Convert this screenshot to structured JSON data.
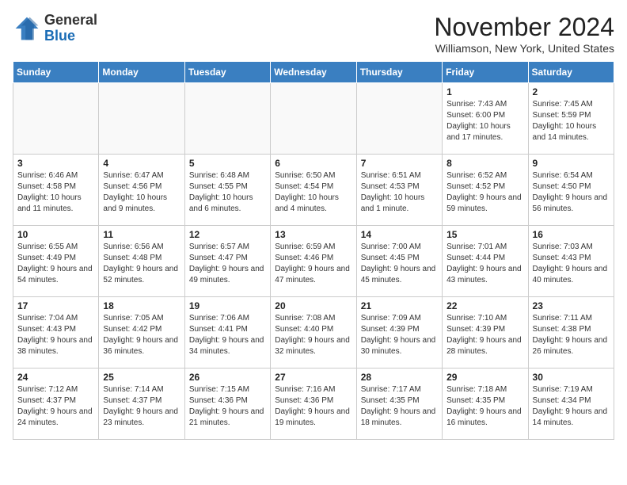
{
  "header": {
    "logo_general": "General",
    "logo_blue": "Blue",
    "month_title": "November 2024",
    "location": "Williamson, New York, United States"
  },
  "days_of_week": [
    "Sunday",
    "Monday",
    "Tuesday",
    "Wednesday",
    "Thursday",
    "Friday",
    "Saturday"
  ],
  "weeks": [
    [
      {
        "day": "",
        "info": ""
      },
      {
        "day": "",
        "info": ""
      },
      {
        "day": "",
        "info": ""
      },
      {
        "day": "",
        "info": ""
      },
      {
        "day": "",
        "info": ""
      },
      {
        "day": "1",
        "info": "Sunrise: 7:43 AM\nSunset: 6:00 PM\nDaylight: 10 hours and 17 minutes."
      },
      {
        "day": "2",
        "info": "Sunrise: 7:45 AM\nSunset: 5:59 PM\nDaylight: 10 hours and 14 minutes."
      }
    ],
    [
      {
        "day": "3",
        "info": "Sunrise: 6:46 AM\nSunset: 4:58 PM\nDaylight: 10 hours and 11 minutes."
      },
      {
        "day": "4",
        "info": "Sunrise: 6:47 AM\nSunset: 4:56 PM\nDaylight: 10 hours and 9 minutes."
      },
      {
        "day": "5",
        "info": "Sunrise: 6:48 AM\nSunset: 4:55 PM\nDaylight: 10 hours and 6 minutes."
      },
      {
        "day": "6",
        "info": "Sunrise: 6:50 AM\nSunset: 4:54 PM\nDaylight: 10 hours and 4 minutes."
      },
      {
        "day": "7",
        "info": "Sunrise: 6:51 AM\nSunset: 4:53 PM\nDaylight: 10 hours and 1 minute."
      },
      {
        "day": "8",
        "info": "Sunrise: 6:52 AM\nSunset: 4:52 PM\nDaylight: 9 hours and 59 minutes."
      },
      {
        "day": "9",
        "info": "Sunrise: 6:54 AM\nSunset: 4:50 PM\nDaylight: 9 hours and 56 minutes."
      }
    ],
    [
      {
        "day": "10",
        "info": "Sunrise: 6:55 AM\nSunset: 4:49 PM\nDaylight: 9 hours and 54 minutes."
      },
      {
        "day": "11",
        "info": "Sunrise: 6:56 AM\nSunset: 4:48 PM\nDaylight: 9 hours and 52 minutes."
      },
      {
        "day": "12",
        "info": "Sunrise: 6:57 AM\nSunset: 4:47 PM\nDaylight: 9 hours and 49 minutes."
      },
      {
        "day": "13",
        "info": "Sunrise: 6:59 AM\nSunset: 4:46 PM\nDaylight: 9 hours and 47 minutes."
      },
      {
        "day": "14",
        "info": "Sunrise: 7:00 AM\nSunset: 4:45 PM\nDaylight: 9 hours and 45 minutes."
      },
      {
        "day": "15",
        "info": "Sunrise: 7:01 AM\nSunset: 4:44 PM\nDaylight: 9 hours and 43 minutes."
      },
      {
        "day": "16",
        "info": "Sunrise: 7:03 AM\nSunset: 4:43 PM\nDaylight: 9 hours and 40 minutes."
      }
    ],
    [
      {
        "day": "17",
        "info": "Sunrise: 7:04 AM\nSunset: 4:43 PM\nDaylight: 9 hours and 38 minutes."
      },
      {
        "day": "18",
        "info": "Sunrise: 7:05 AM\nSunset: 4:42 PM\nDaylight: 9 hours and 36 minutes."
      },
      {
        "day": "19",
        "info": "Sunrise: 7:06 AM\nSunset: 4:41 PM\nDaylight: 9 hours and 34 minutes."
      },
      {
        "day": "20",
        "info": "Sunrise: 7:08 AM\nSunset: 4:40 PM\nDaylight: 9 hours and 32 minutes."
      },
      {
        "day": "21",
        "info": "Sunrise: 7:09 AM\nSunset: 4:39 PM\nDaylight: 9 hours and 30 minutes."
      },
      {
        "day": "22",
        "info": "Sunrise: 7:10 AM\nSunset: 4:39 PM\nDaylight: 9 hours and 28 minutes."
      },
      {
        "day": "23",
        "info": "Sunrise: 7:11 AM\nSunset: 4:38 PM\nDaylight: 9 hours and 26 minutes."
      }
    ],
    [
      {
        "day": "24",
        "info": "Sunrise: 7:12 AM\nSunset: 4:37 PM\nDaylight: 9 hours and 24 minutes."
      },
      {
        "day": "25",
        "info": "Sunrise: 7:14 AM\nSunset: 4:37 PM\nDaylight: 9 hours and 23 minutes."
      },
      {
        "day": "26",
        "info": "Sunrise: 7:15 AM\nSunset: 4:36 PM\nDaylight: 9 hours and 21 minutes."
      },
      {
        "day": "27",
        "info": "Sunrise: 7:16 AM\nSunset: 4:36 PM\nDaylight: 9 hours and 19 minutes."
      },
      {
        "day": "28",
        "info": "Sunrise: 7:17 AM\nSunset: 4:35 PM\nDaylight: 9 hours and 18 minutes."
      },
      {
        "day": "29",
        "info": "Sunrise: 7:18 AM\nSunset: 4:35 PM\nDaylight: 9 hours and 16 minutes."
      },
      {
        "day": "30",
        "info": "Sunrise: 7:19 AM\nSunset: 4:34 PM\nDaylight: 9 hours and 14 minutes."
      }
    ]
  ]
}
